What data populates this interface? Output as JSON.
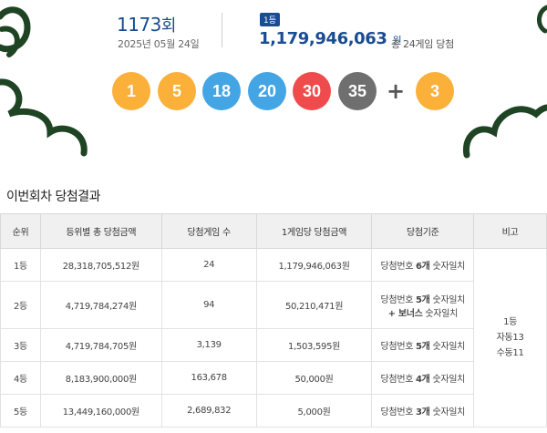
{
  "draw": {
    "round_number": "1173",
    "round_suffix": "회",
    "date": "2025년 05월 24일",
    "first_badge": "1등",
    "first_prize": "1,179,946,063",
    "won_unit": "원",
    "winners_text": "총 24게임 당첨"
  },
  "balls": [
    {
      "num": "1",
      "color": "#fbb039"
    },
    {
      "num": "5",
      "color": "#fbb039"
    },
    {
      "num": "18",
      "color": "#44a5e4"
    },
    {
      "num": "20",
      "color": "#44a5e4"
    },
    {
      "num": "30",
      "color": "#f04b4c"
    },
    {
      "num": "35",
      "color": "#6f6f6f"
    }
  ],
  "plus": "+",
  "bonus": {
    "num": "3",
    "color": "#fbb039"
  },
  "section_title": "이번회차 당첨결과",
  "table": {
    "headers": [
      "순위",
      "등위별 총 당첨금액",
      "당첨게임 수",
      "1게임당 당첨금액",
      "당첨기준",
      "비고"
    ],
    "rows": [
      {
        "rank": "1등",
        "total": "28,318,705,512원",
        "games": "24",
        "per_game": "1,179,946,063원",
        "std_pre": "당첨번호 ",
        "std_bold": "6개",
        "std_post": " 숫자일치",
        "std2_bold": "",
        "std2_post": ""
      },
      {
        "rank": "2등",
        "total": "4,719,784,274원",
        "games": "94",
        "per_game": "50,210,471원",
        "std_pre": "당첨번호 ",
        "std_bold": "5개",
        "std_post": " 숫자일치",
        "std2_bold": "+ 보너스",
        "std2_post": " 숫자일치"
      },
      {
        "rank": "3등",
        "total": "4,719,784,705원",
        "games": "3,139",
        "per_game": "1,503,595원",
        "std_pre": "당첨번호 ",
        "std_bold": "5개",
        "std_post": " 숫자일치",
        "std2_bold": "",
        "std2_post": ""
      },
      {
        "rank": "4등",
        "total": "8,183,900,000원",
        "games": "163,678",
        "per_game": "50,000원",
        "std_pre": "당첨번호 ",
        "std_bold": "4개",
        "std_post": " 숫자일치",
        "std2_bold": "",
        "std2_post": ""
      },
      {
        "rank": "5등",
        "total": "13,449,160,000원",
        "games": "2,689,832",
        "per_game": "5,000원",
        "std_pre": "당첨번호 ",
        "std_bold": "3개",
        "std_post": " 숫자일치",
        "std2_bold": "",
        "std2_post": ""
      }
    ],
    "note": [
      "1등",
      "자동13",
      "수동11"
    ]
  },
  "colors": {
    "accent": "#1a4c92",
    "deco": "#1f4424"
  }
}
